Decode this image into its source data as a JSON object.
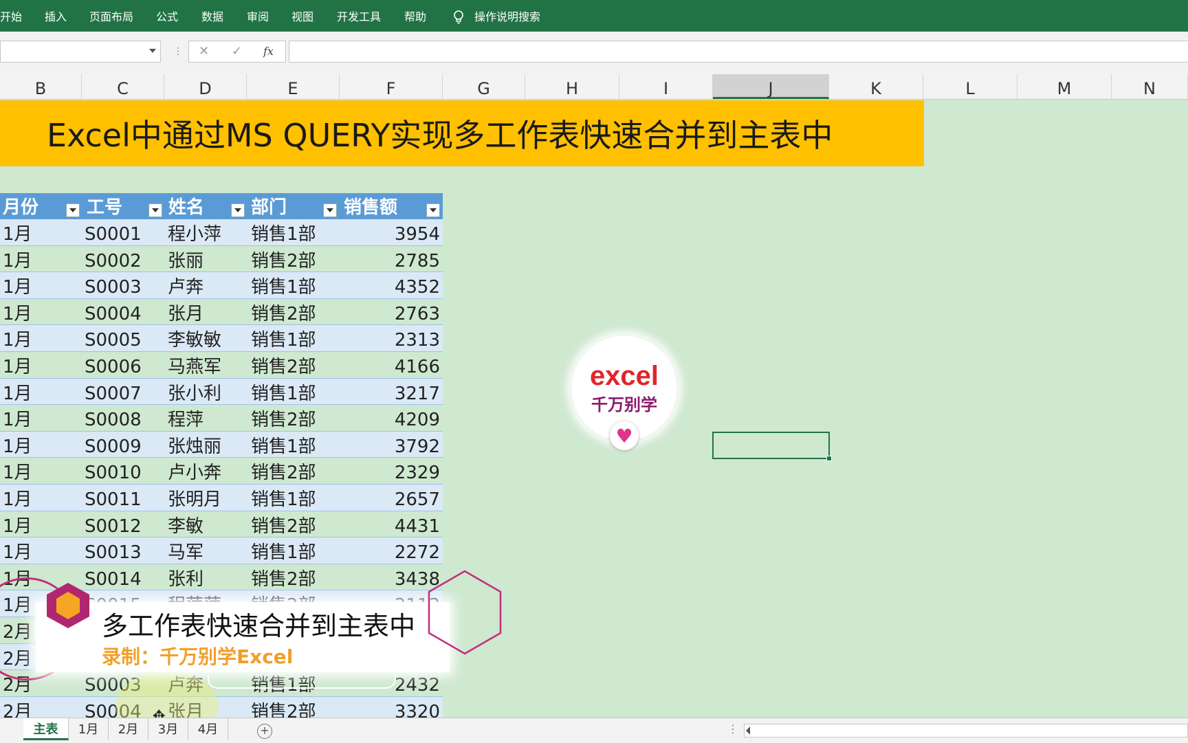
{
  "ribbon": {
    "tabs": [
      "开始",
      "插入",
      "页面布局",
      "公式",
      "数据",
      "审阅",
      "视图",
      "开发工具",
      "帮助"
    ],
    "search_label": "操作说明搜索"
  },
  "formula_bar": {
    "name_box": "",
    "cancel_icon": "✕",
    "enter_icon": "✓",
    "fx_label": "fx",
    "formula": ""
  },
  "columns": [
    "B",
    "C",
    "D",
    "E",
    "F",
    "G",
    "H",
    "I",
    "J",
    "K",
    "L",
    "M",
    "N"
  ],
  "selected_column": "J",
  "banner": {
    "title": "Excel中通过MS QUERY实现多工作表快速合并到主表中"
  },
  "table": {
    "headers": [
      "月份",
      "工号",
      "姓名",
      "部门",
      "销售额"
    ],
    "rows": [
      [
        "1月",
        "S0001",
        "程小萍",
        "销售1部",
        "3954"
      ],
      [
        "1月",
        "S0002",
        "张丽",
        "销售2部",
        "2785"
      ],
      [
        "1月",
        "S0003",
        "卢奔",
        "销售1部",
        "4352"
      ],
      [
        "1月",
        "S0004",
        "张月",
        "销售2部",
        "2763"
      ],
      [
        "1月",
        "S0005",
        "李敏敏",
        "销售1部",
        "2313"
      ],
      [
        "1月",
        "S0006",
        "马燕军",
        "销售2部",
        "4166"
      ],
      [
        "1月",
        "S0007",
        "张小利",
        "销售1部",
        "3217"
      ],
      [
        "1月",
        "S0008",
        "程萍",
        "销售2部",
        "4209"
      ],
      [
        "1月",
        "S0009",
        "张烛丽",
        "销售1部",
        "3792"
      ],
      [
        "1月",
        "S0010",
        "卢小奔",
        "销售2部",
        "2329"
      ],
      [
        "1月",
        "S0011",
        "张明月",
        "销售1部",
        "2657"
      ],
      [
        "1月",
        "S0012",
        "李敏",
        "销售2部",
        "4431"
      ],
      [
        "1月",
        "S0013",
        "马军",
        "销售1部",
        "2272"
      ],
      [
        "1月",
        "S0014",
        "张利",
        "销售2部",
        "3438"
      ],
      [
        "1月",
        "S0015",
        "程萍萍",
        "销售2部",
        "2113"
      ],
      [
        "2月",
        "",
        "",
        "",
        ""
      ],
      [
        "2月",
        "",
        "",
        "",
        ""
      ],
      [
        "2月",
        "S0003",
        "卢奔",
        "销售1部",
        "2432"
      ],
      [
        "2月",
        "S0004",
        "张月",
        "销售2部",
        "3320"
      ]
    ]
  },
  "logo": {
    "word": "excel",
    "subtitle": "千万别学"
  },
  "overlay": {
    "title": "多工作表快速合并到主表中",
    "subtitle": "录制：千万别学Excel"
  },
  "sheet_tabs": [
    "主表",
    "1月",
    "2月",
    "3月",
    "4月"
  ],
  "active_sheet": "主表",
  "colors": {
    "ribbon": "#217346",
    "banner": "#ffc000",
    "table_header": "#5b9bd5",
    "sheet_bg": "#cfe8d0"
  }
}
